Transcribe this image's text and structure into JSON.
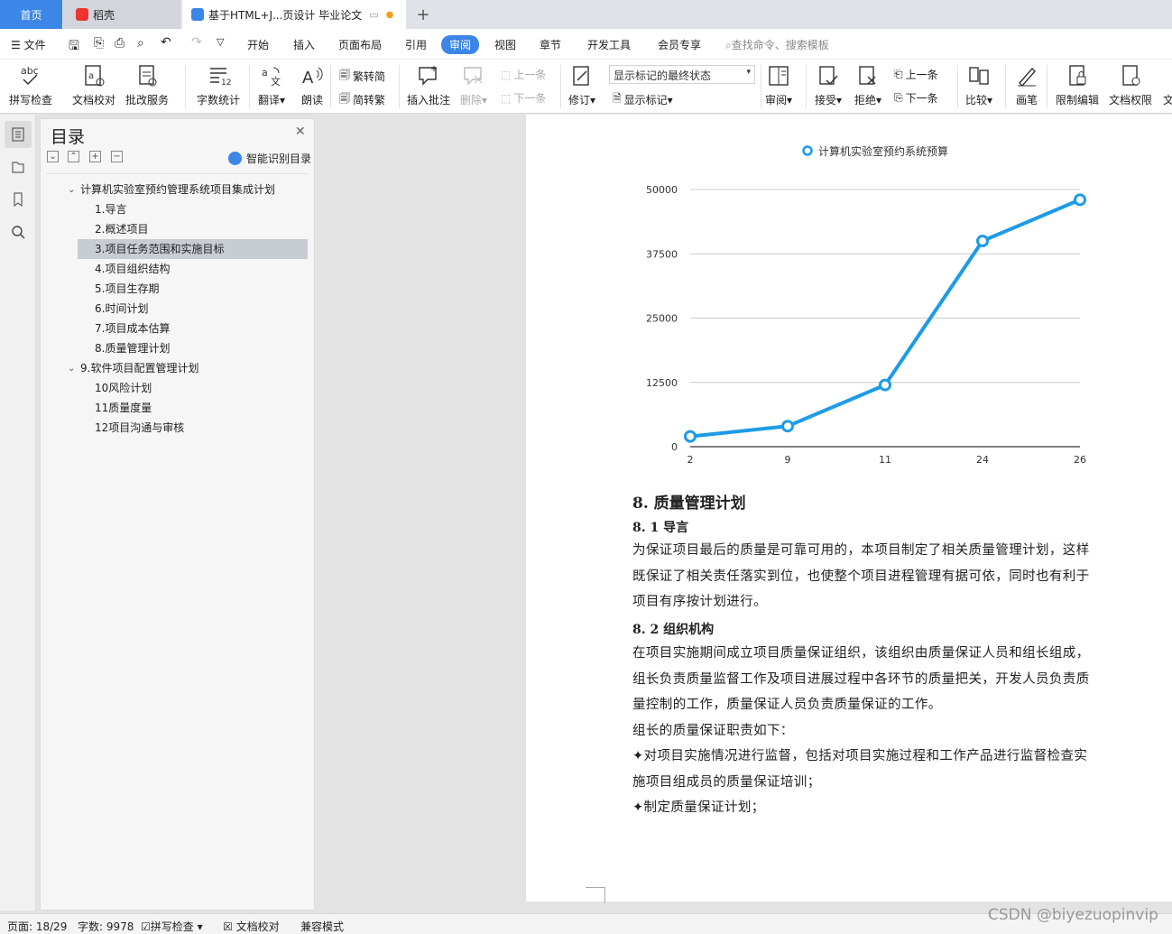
{
  "tabs": {
    "home": "首页",
    "daoke": "稻壳",
    "doc_title": "基于HTML+J...页设计 毕业论文"
  },
  "menu": {
    "file": "文件",
    "items": [
      "开始",
      "插入",
      "页面布局",
      "引用",
      "审阅",
      "视图",
      "章节",
      "开发工具",
      "会员专享"
    ],
    "search_placeholder": "查找命令、搜索模板"
  },
  "ribbon": {
    "spell": "拼写检查",
    "proof": "文档校对",
    "comment_service": "批改服务",
    "word_count": "字数统计",
    "translate": "翻译",
    "read_aloud": "朗读",
    "trad_to_simp": "繁转简",
    "simp_to_trad": "简转繁",
    "insert_comment": "插入批注",
    "delete": "删除",
    "prev": "上一条",
    "next": "下一条",
    "track": "修订",
    "markup_state": "显示标记的最终状态",
    "show_markup": "显示标记",
    "review": "审阅",
    "accept": "接受",
    "reject": "拒绝",
    "prev2": "上一条",
    "next2": "下一条",
    "compare": "比较",
    "pen": "画笔",
    "restrict": "限制编辑",
    "doc_rights": "文档权限",
    "more": "文"
  },
  "toc": {
    "title": "目录",
    "smart": "智能识别目录",
    "items": [
      {
        "label": "计算机实验室预约管理系统项目集成计划",
        "level": 1
      },
      {
        "label": "1.导言",
        "level": 2
      },
      {
        "label": "2.概述项目",
        "level": 2
      },
      {
        "label": "3.项目任务范围和实施目标",
        "level": 2
      },
      {
        "label": "4.项目组织结构",
        "level": 2
      },
      {
        "label": "5.项目生存期",
        "level": 2
      },
      {
        "label": "6.时间计划",
        "level": 2
      },
      {
        "label": "7.项目成本估算",
        "level": 2
      },
      {
        "label": "8.质量管理计划",
        "level": 2
      },
      {
        "label": "9.软件项目配置管理计划",
        "level": 1
      },
      {
        "label": "10风险计划",
        "level": 2
      },
      {
        "label": "11质量度量",
        "level": 2
      },
      {
        "label": "12项目沟通与审核",
        "level": 2
      }
    ]
  },
  "chart_data": {
    "type": "line",
    "title": "",
    "categories": [
      "2",
      "9",
      "11",
      "24",
      "26"
    ],
    "series": [
      {
        "name": "计算机实验室预约系统预算",
        "values": [
          2000,
          4000,
          12000,
          40000,
          48000
        ]
      }
    ],
    "yticks": [
      "0",
      "12500",
      "25000",
      "37500",
      "50000"
    ],
    "ylim": [
      0,
      50000
    ],
    "grid": true,
    "legend": "top",
    "color": "#1e9be6"
  },
  "doc": {
    "h1": "8. 质量管理计划",
    "h2a": "8. 1 导言",
    "p1": [
      "为保证项目最后的质量是可靠可用的，本项目制定了相关质量管理计划，这样",
      "既保证了相关责任落实到位，也使整个项目进程管理有据可依，同时也有利于",
      "项目有序按计划进行。"
    ],
    "h2b": "8. 2 组织机构",
    "p2": [
      "在项目实施期间成立项目质量保证组织，该组织由质量保证人员和组长组成，",
      "组长负责质量监督工作及项目进展过程中各环节的质量把关，开发人员负责质",
      "量控制的工作，质量保证人员负责质量保证的工作。"
    ],
    "p3": "组长的质量保证职责如下：",
    "b1": [
      "✦对项目实施情况进行监督，包括对项目实施过程和工作产品进行监督检查实",
      "施项目组成员的质量保证培训；"
    ],
    "b2": "✦制定质量保证计划；"
  },
  "status": {
    "page": "页面: 18/29",
    "words": "字数: 9978",
    "spell": "拼写检查",
    "proof": "文档校对",
    "compat": "兼容模式"
  },
  "watermark": "CSDN @biyezuopinvip"
}
